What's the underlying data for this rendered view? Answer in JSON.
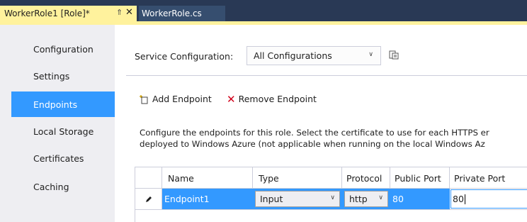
{
  "tabs": {
    "active": {
      "label": "WorkerRole1 [Role]*"
    },
    "inactive": {
      "label": "WorkerRole.cs"
    }
  },
  "sidebar": {
    "items": [
      {
        "label": "Configuration"
      },
      {
        "label": "Settings"
      },
      {
        "label": "Endpoints",
        "selected": true
      },
      {
        "label": "Local Storage"
      },
      {
        "label": "Certificates"
      },
      {
        "label": "Caching"
      }
    ]
  },
  "service_config": {
    "label": "Service Configuration:",
    "value": "All Configurations"
  },
  "toolbar": {
    "add_label": "Add Endpoint",
    "remove_label": "Remove Endpoint"
  },
  "description": {
    "line1": "Configure the endpoints for this role.  Select the certificate to use for each HTTPS er",
    "line2": "deployed to Windows Azure (not applicable when running on the local Windows Az"
  },
  "grid": {
    "columns": [
      "Name",
      "Type",
      "Protocol",
      "Public Port",
      "Private Port"
    ],
    "rows": [
      {
        "name": "Endpoint1",
        "type": "Input",
        "protocol": "http",
        "public_port": "80",
        "private_port": "80"
      }
    ]
  },
  "colors": {
    "selection": "#3399ff",
    "tab_active": "#fff29d",
    "chrome": "#293955"
  }
}
